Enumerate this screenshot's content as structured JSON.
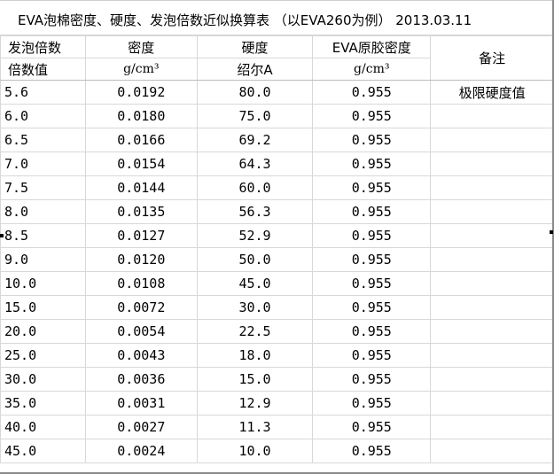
{
  "title": "EVA泡棉密度、硬度、发泡倍数近似换算表 （以EVA260为例） 2013.03.11",
  "header": {
    "col1_line1": "发泡倍数",
    "col1_line2": "倍数值",
    "col2_line1": "密度",
    "col2_line2": "g/cm³",
    "col3_line1": "硬度",
    "col3_line2": "绍尔A",
    "col4_line1": "EVA原胶密度",
    "col4_line2": "g/cm³",
    "col5": "备注"
  },
  "rows": [
    {
      "foam": "5.6",
      "density": "0.0192",
      "hardness": "80.0",
      "raw_density": "0.955",
      "note": "极限硬度值"
    },
    {
      "foam": "6.0",
      "density": "0.0180",
      "hardness": "75.0",
      "raw_density": "0.955",
      "note": ""
    },
    {
      "foam": "6.5",
      "density": "0.0166",
      "hardness": "69.2",
      "raw_density": "0.955",
      "note": ""
    },
    {
      "foam": "7.0",
      "density": "0.0154",
      "hardness": "64.3",
      "raw_density": "0.955",
      "note": ""
    },
    {
      "foam": "7.5",
      "density": "0.0144",
      "hardness": "60.0",
      "raw_density": "0.955",
      "note": ""
    },
    {
      "foam": "8.0",
      "density": "0.0135",
      "hardness": "56.3",
      "raw_density": "0.955",
      "note": ""
    },
    {
      "foam": "8.5",
      "density": "0.0127",
      "hardness": "52.9",
      "raw_density": "0.955",
      "note": ""
    },
    {
      "foam": "9.0",
      "density": "0.0120",
      "hardness": "50.0",
      "raw_density": "0.955",
      "note": ""
    },
    {
      "foam": "10.0",
      "density": "0.0108",
      "hardness": "45.0",
      "raw_density": "0.955",
      "note": ""
    },
    {
      "foam": "15.0",
      "density": "0.0072",
      "hardness": "30.0",
      "raw_density": "0.955",
      "note": ""
    },
    {
      "foam": "20.0",
      "density": "0.0054",
      "hardness": "22.5",
      "raw_density": "0.955",
      "note": ""
    },
    {
      "foam": "25.0",
      "density": "0.0043",
      "hardness": "18.0",
      "raw_density": "0.955",
      "note": ""
    },
    {
      "foam": "30.0",
      "density": "0.0036",
      "hardness": "15.0",
      "raw_density": "0.955",
      "note": ""
    },
    {
      "foam": "35.0",
      "density": "0.0031",
      "hardness": "12.9",
      "raw_density": "0.955",
      "note": ""
    },
    {
      "foam": "40.0",
      "density": "0.0027",
      "hardness": "11.3",
      "raw_density": "0.955",
      "note": ""
    },
    {
      "foam": "45.0",
      "density": "0.0024",
      "hardness": "10.0",
      "raw_density": "0.955",
      "note": ""
    }
  ]
}
